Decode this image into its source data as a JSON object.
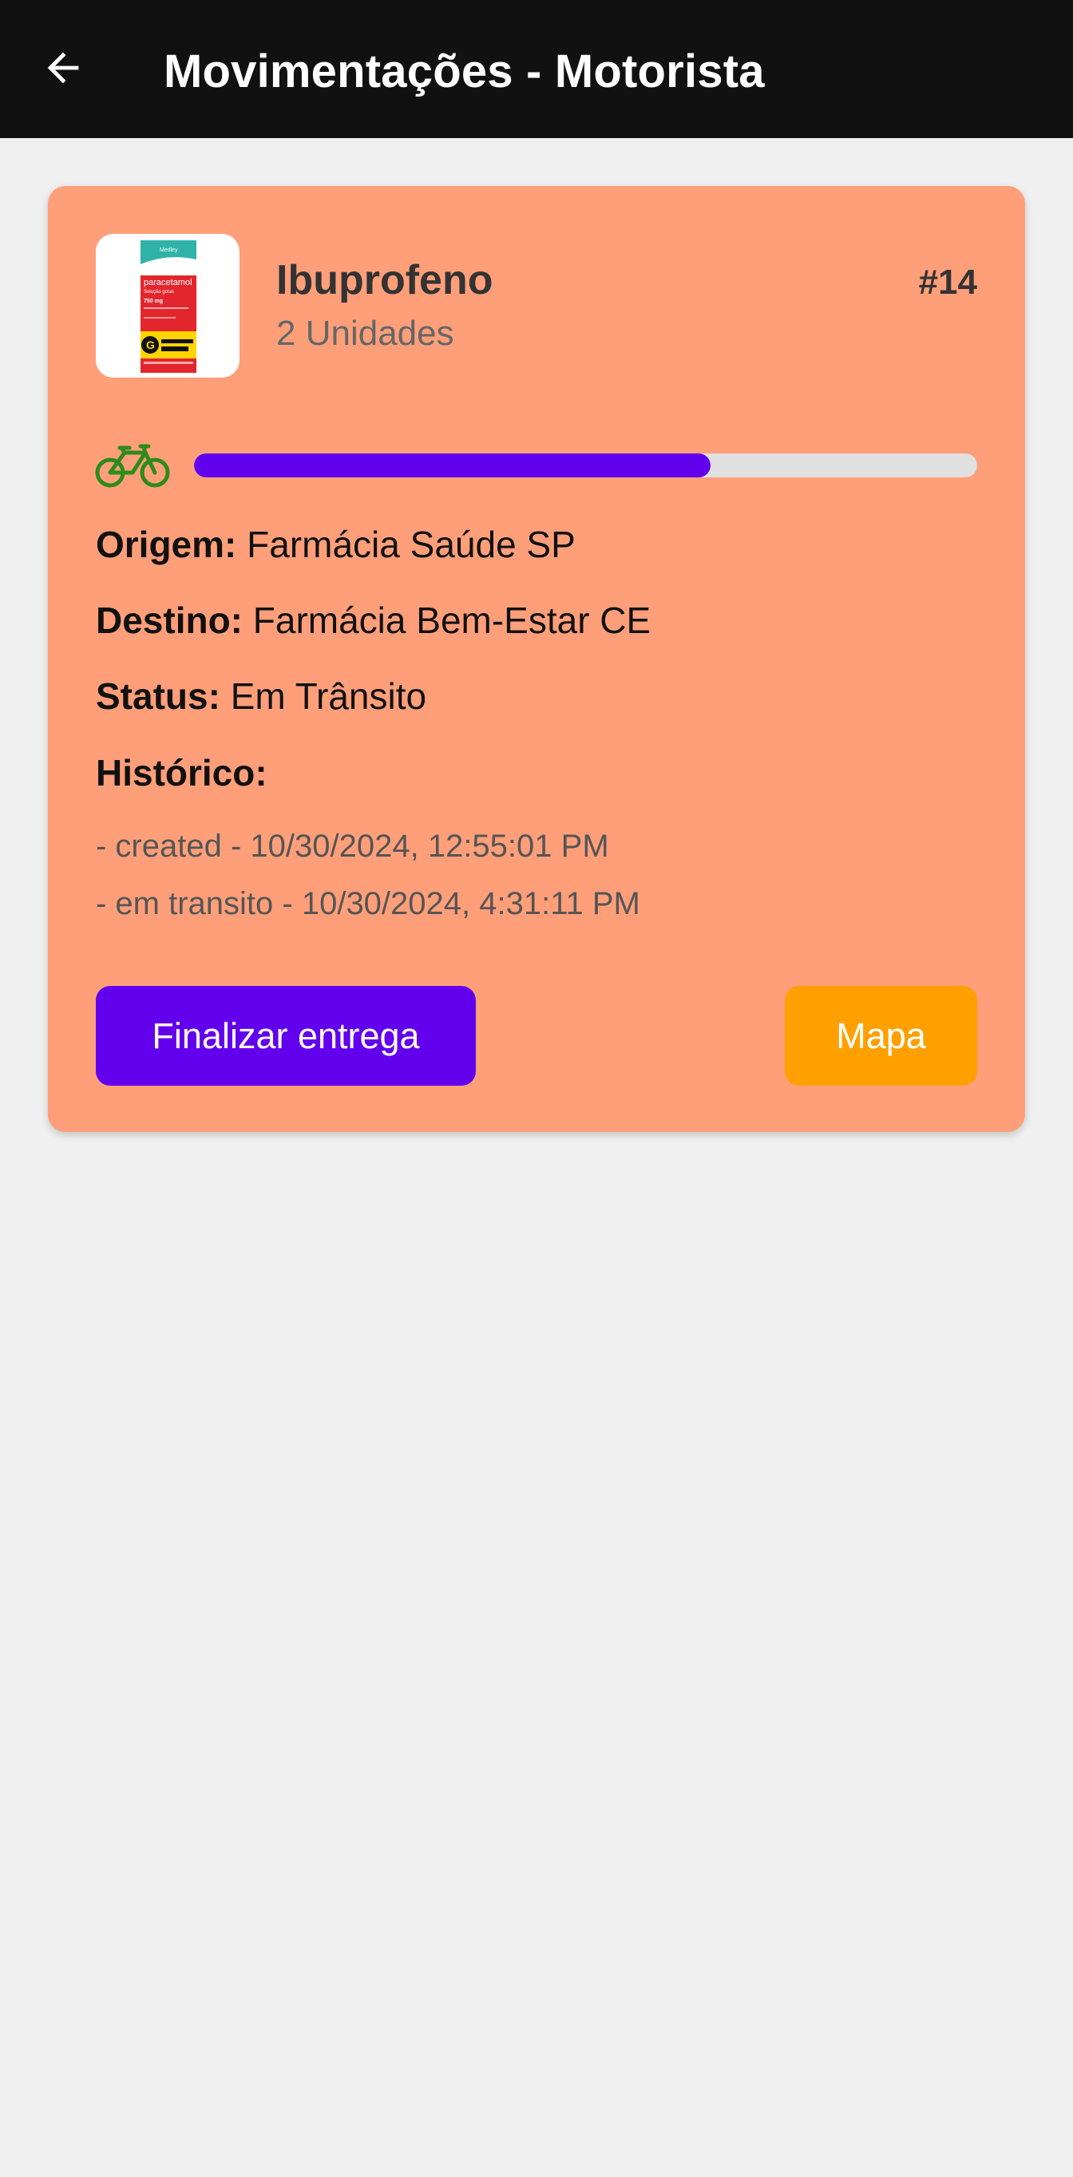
{
  "appbar": {
    "title": "Movimentações - Motorista",
    "back_icon": "arrow-left-icon"
  },
  "card": {
    "product": {
      "name": "Ibuprofeno",
      "quantity": "2 Unidades",
      "id": "#14",
      "thumbnail": {
        "brand_top": "Medley",
        "name": "paracetamol",
        "form": "Solução gotas",
        "dose": "750 mg",
        "badge": "Medicamento Genérico"
      }
    },
    "transport_icon": "bicycle-icon",
    "progress": 0.66,
    "origin_label": "Origem:",
    "origin_value": "Farmácia Saúde SP",
    "destination_label": "Destino:",
    "destination_value": "Farmácia Bem-Estar CE",
    "status_label": "Status:",
    "status_value": "Em Trânsito",
    "history_title": "Histórico:",
    "history": [
      "- created - 10/30/2024, 12:55:01 PM",
      "- em transito - 10/30/2024, 4:31:11 PM"
    ],
    "finish_button": "Finalizar entrega",
    "map_button": "Mapa"
  },
  "colors": {
    "appbar": "#111111",
    "card": "#ff9f7a",
    "primary": "#6200ee",
    "map_button": "#ffa000",
    "bike": "#2e8b1a",
    "background": "#f0f0f0"
  }
}
